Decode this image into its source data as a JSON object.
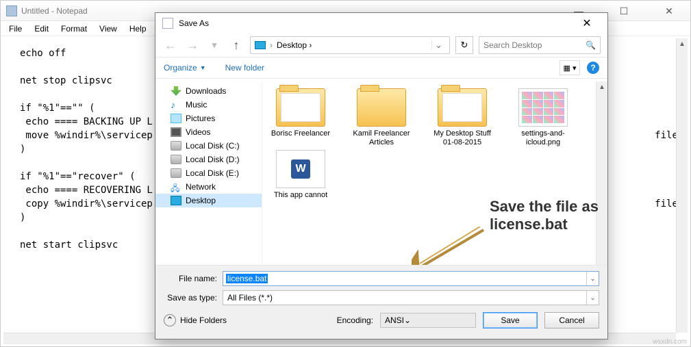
{
  "notepad": {
    "title": "Untitled - Notepad",
    "menu": [
      "File",
      "Edit",
      "Format",
      "View",
      "Help"
    ],
    "body": "echo off\n\nnet stop clipsvc\n\nif \"%1\"==\"\" (\n echo ==== BACKING UP L\n move %windir%\\servicep                                                                                       files\\locals…\n)\n\nif \"%1\"==\"recover\" (\n echo ==== RECOVERING L\n copy %windir%\\servicep                                                                                       files\\locals…\n)\n\nnet start clipsvc"
  },
  "dialog": {
    "title": "Save As",
    "breadcrumb": "Desktop  ›",
    "search_placeholder": "Search Desktop",
    "organize": "Organize",
    "newfolder": "New folder",
    "tree": [
      {
        "label": "Downloads",
        "cls": "dl-icon"
      },
      {
        "label": "Music",
        "cls": "music-icon",
        "glyph": "♪"
      },
      {
        "label": "Pictures",
        "cls": "pic-icon"
      },
      {
        "label": "Videos",
        "cls": "vid-icon"
      },
      {
        "label": "Local Disk (C:)",
        "cls": "disk-icon"
      },
      {
        "label": "Local Disk (D:)",
        "cls": "disk-icon"
      },
      {
        "label": "Local Disk (E:)",
        "cls": "disk-icon"
      },
      {
        "label": "Network",
        "cls": "net-icon",
        "glyph": "🖧"
      },
      {
        "label": "Desktop",
        "cls": "desk-icon",
        "sel": true
      }
    ],
    "files": [
      {
        "label": "Borisc Freelancer",
        "type": "folder",
        "inner": true
      },
      {
        "label": "Kamil Freelancer Articles",
        "type": "folder"
      },
      {
        "label": "My Desktop Stuff 01-08-2015",
        "type": "folder",
        "inner": true
      },
      {
        "label": "settings-and-icloud.png",
        "type": "png"
      },
      {
        "label": "This app cannot",
        "type": "doc"
      }
    ],
    "annotation_l1": "Save the file as",
    "annotation_l2": "license.bat",
    "filename_label": "File name:",
    "filename_value": "license.bat",
    "savetype_label": "Save as type:",
    "savetype_value": "All Files  (*.*)",
    "hide_folders": "Hide Folders",
    "encoding_label": "Encoding:",
    "encoding_value": "ANSI",
    "save_btn": "Save",
    "cancel_btn": "Cancel"
  },
  "watermark": "wsxdn.com"
}
